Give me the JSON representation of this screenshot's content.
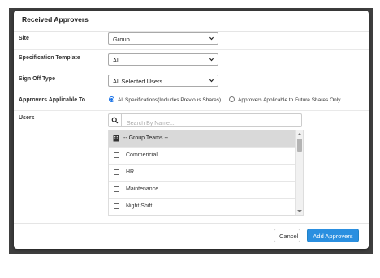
{
  "modal": {
    "title": "Received Approvers"
  },
  "fields": {
    "site": {
      "label": "Site",
      "value": "Group"
    },
    "spec_template": {
      "label": "Specification Template",
      "value": "All"
    },
    "sign_off_type": {
      "label": "Sign Off Type",
      "value": "All Selected Users"
    },
    "approvers_applicable": {
      "label": "Approvers Applicable To",
      "options": [
        {
          "label": "All Specifications(Includes Previous Shares)",
          "checked": true
        },
        {
          "label": "Approvers Applicable to Future Shares Only",
          "checked": false
        }
      ]
    },
    "users": {
      "label": "Users",
      "search_placeholder": "Search By Name...",
      "group_header": "-- Group Teams --",
      "items": [
        "Commericial",
        "HR",
        "Maintenance",
        "Night Shift"
      ]
    }
  },
  "footer": {
    "cancel_label": "Cancel",
    "add_label": "Add Approvers"
  },
  "colors": {
    "primary_button": "#2a8fe0",
    "radio_accent": "#1a73e8",
    "backdrop": "#3f3f3f"
  }
}
